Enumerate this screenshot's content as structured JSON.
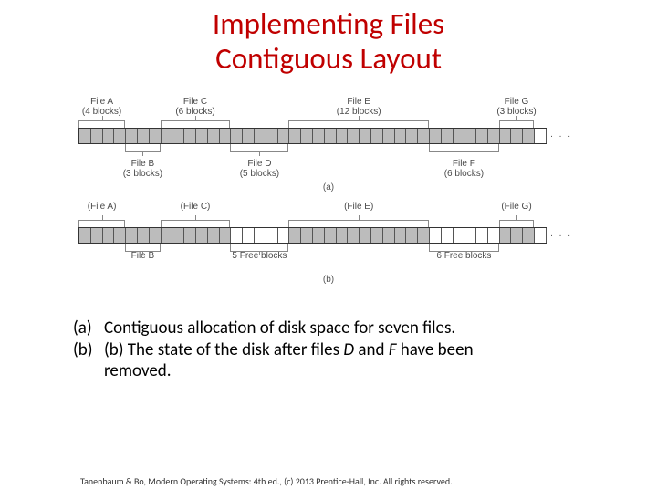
{
  "title_line1": "Implementing Files",
  "title_line2": "Contiguous Layout",
  "fig": {
    "a": {
      "top": [
        {
          "name": "File A",
          "sub": "(4 blocks)",
          "start": 0,
          "len": 4
        },
        {
          "name": "File C",
          "sub": "(6 blocks)",
          "start": 7,
          "len": 6
        },
        {
          "name": "File E",
          "sub": "(12 blocks)",
          "start": 18,
          "len": 12
        },
        {
          "name": "File G",
          "sub": "(3 blocks)",
          "start": 36,
          "len": 3
        }
      ],
      "bot": [
        {
          "name": "File B",
          "sub": "(3 blocks)",
          "start": 4,
          "len": 3
        },
        {
          "name": "File D",
          "sub": "(5 blocks)",
          "start": 13,
          "len": 5
        },
        {
          "name": "File F",
          "sub": "(6 blocks)",
          "start": 30,
          "len": 6
        }
      ],
      "cap": "(a)",
      "blocks": [
        {
          "len": 4,
          "used": true
        },
        {
          "len": 3,
          "used": true
        },
        {
          "len": 6,
          "used": true
        },
        {
          "len": 5,
          "used": true
        },
        {
          "len": 12,
          "used": true
        },
        {
          "len": 6,
          "used": true
        },
        {
          "len": 3,
          "used": true
        },
        {
          "len": 1,
          "used": false
        }
      ]
    },
    "b": {
      "top": [
        {
          "name": "(File A)",
          "sub": "",
          "start": 0,
          "len": 4
        },
        {
          "name": "(File C)",
          "sub": "",
          "start": 7,
          "len": 6
        },
        {
          "name": "(File E)",
          "sub": "",
          "start": 18,
          "len": 12
        },
        {
          "name": "(File G)",
          "sub": "",
          "start": 36,
          "len": 3
        }
      ],
      "bot": [
        {
          "name": "File B",
          "sub": "",
          "start": 4,
          "len": 3
        },
        {
          "name": "5 Free blocks",
          "sub": "",
          "start": 13,
          "len": 5
        },
        {
          "name": "6 Free blocks",
          "sub": "",
          "start": 30,
          "len": 6
        }
      ],
      "cap": "(b)",
      "blocks": [
        {
          "len": 4,
          "used": true
        },
        {
          "len": 3,
          "used": true
        },
        {
          "len": 6,
          "used": true
        },
        {
          "len": 5,
          "used": false
        },
        {
          "len": 12,
          "used": true
        },
        {
          "len": 6,
          "used": false
        },
        {
          "len": 3,
          "used": true
        },
        {
          "len": 1,
          "used": false
        }
      ]
    },
    "ellipsis": ". . ."
  },
  "caption_a_tag": "(a)",
  "caption_a": "Contiguous allocation of disk space for seven files.",
  "caption_b_tag": "(b)",
  "caption_b_1": "(b) The state of the disk after files ",
  "caption_b_D": "D",
  "caption_b_2": " and ",
  "caption_b_F": "F",
  "caption_b_3": " have been",
  "caption_b_4": "removed.",
  "footer": "Tanenbaum & Bo, Modern Operating Systems: 4th ed., (c) 2013 Prentice-Hall, Inc. All rights reserved."
}
